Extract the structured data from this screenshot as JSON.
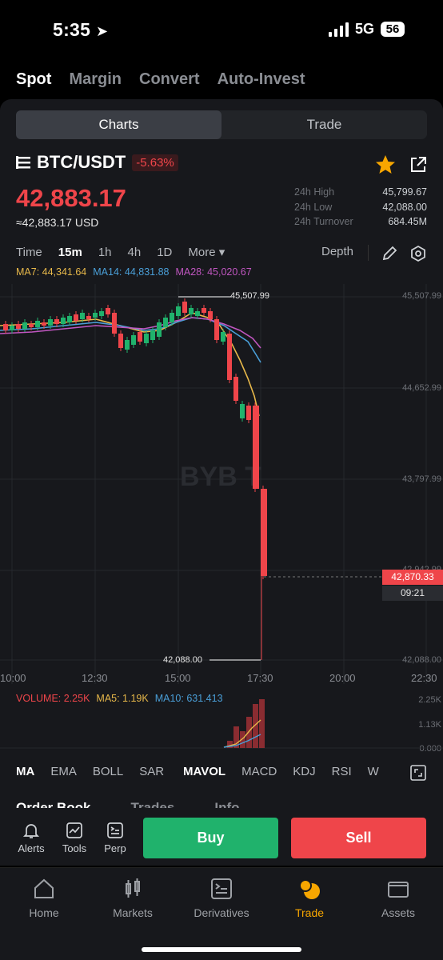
{
  "status": {
    "time": "5:35",
    "network": "5G",
    "battery": "56"
  },
  "top_tabs": [
    "Spot",
    "Margin",
    "Convert",
    "Auto-Invest"
  ],
  "segment": {
    "charts": "Charts",
    "trade": "Trade"
  },
  "pair": {
    "name": "BTC/USDT",
    "change": "-5.63%"
  },
  "price": {
    "last": "42,883.17",
    "usd": "≈42,883.17 USD"
  },
  "stats": [
    {
      "label": "24h High",
      "value": "45,799.67"
    },
    {
      "label": "24h Low",
      "value": "42,088.00"
    },
    {
      "label": "24h Turnover",
      "value": "684.45M"
    }
  ],
  "timeframes": {
    "time": "Time",
    "m15": "15m",
    "h1": "1h",
    "h4": "4h",
    "d1": "1D",
    "more": "More ▾",
    "depth": "Depth"
  },
  "ma": {
    "ma7": "MA7: 44,341.64",
    "ma14": "MA14: 44,831.88",
    "ma28": "MA28: 45,020.67"
  },
  "colors": {
    "up": "#20b26c",
    "down": "#ef454a",
    "accent": "#f7a600",
    "ma7": "#e7b84a",
    "ma14": "#4a9fd8",
    "ma28": "#c056c0"
  },
  "y_axis": [
    "45,507.99",
    "44,652.99",
    "43,797.99",
    "42,942.99",
    "42,088.00"
  ],
  "x_axis": [
    "10:00",
    "12:30",
    "15:00",
    "17:30",
    "20:00",
    "22:30"
  ],
  "annotations": {
    "high": "45,507.99",
    "low": "42,088.00",
    "current_price": "42,870.33",
    "countdown": "09:21"
  },
  "watermark": "BYBIT",
  "volume": {
    "vol": "VOLUME: 2.25K",
    "ma5": "MA5: 1.19K",
    "ma10": "MA10: 631.413",
    "axis": [
      "2.25K",
      "1.13K",
      "0.000"
    ]
  },
  "indicators": [
    "MA",
    "EMA",
    "BOLL",
    "SAR",
    "MAVOL",
    "MACD",
    "KDJ",
    "RSI",
    "W"
  ],
  "orderbook_tabs": [
    "Order Book",
    "Trades",
    "Info"
  ],
  "tools": [
    "Alerts",
    "Tools",
    "Perp"
  ],
  "actions": {
    "buy": "Buy",
    "sell": "Sell"
  },
  "tabbar": [
    "Home",
    "Markets",
    "Derivatives",
    "Trade",
    "Assets"
  ]
}
